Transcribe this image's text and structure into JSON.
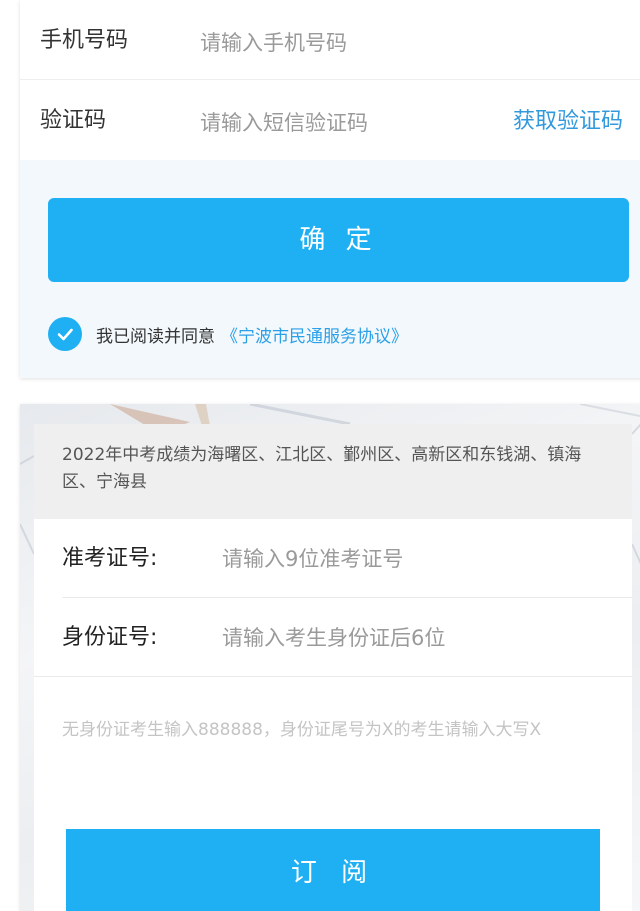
{
  "login": {
    "phone_label": "手机号码",
    "phone_placeholder": "请输入手机号码",
    "code_label": "验证码",
    "code_placeholder": "请输入短信验证码",
    "get_code_label": "获取验证码",
    "confirm_label": "确 定",
    "agree_text": "我已阅读并同意",
    "agreement_link": "《宁波市民通服务协议》",
    "agreed": true
  },
  "subscription": {
    "notice": "2022年中考成绩为海曙区、江北区、鄞州区、高新区和东钱湖、镇海区、宁海县",
    "exam_id_label": "准考证号:",
    "exam_id_placeholder": "请输入9位准考证号",
    "id_card_label": "身份证号:",
    "id_card_placeholder": "请输入考生身份证后6位",
    "hint": "无身份证考生输入888888，身份证尾号为X的考生请输入大写X",
    "subscribe_label": "订 阅"
  },
  "colors": {
    "accent": "#1fb0f3",
    "link": "#3399dd"
  }
}
